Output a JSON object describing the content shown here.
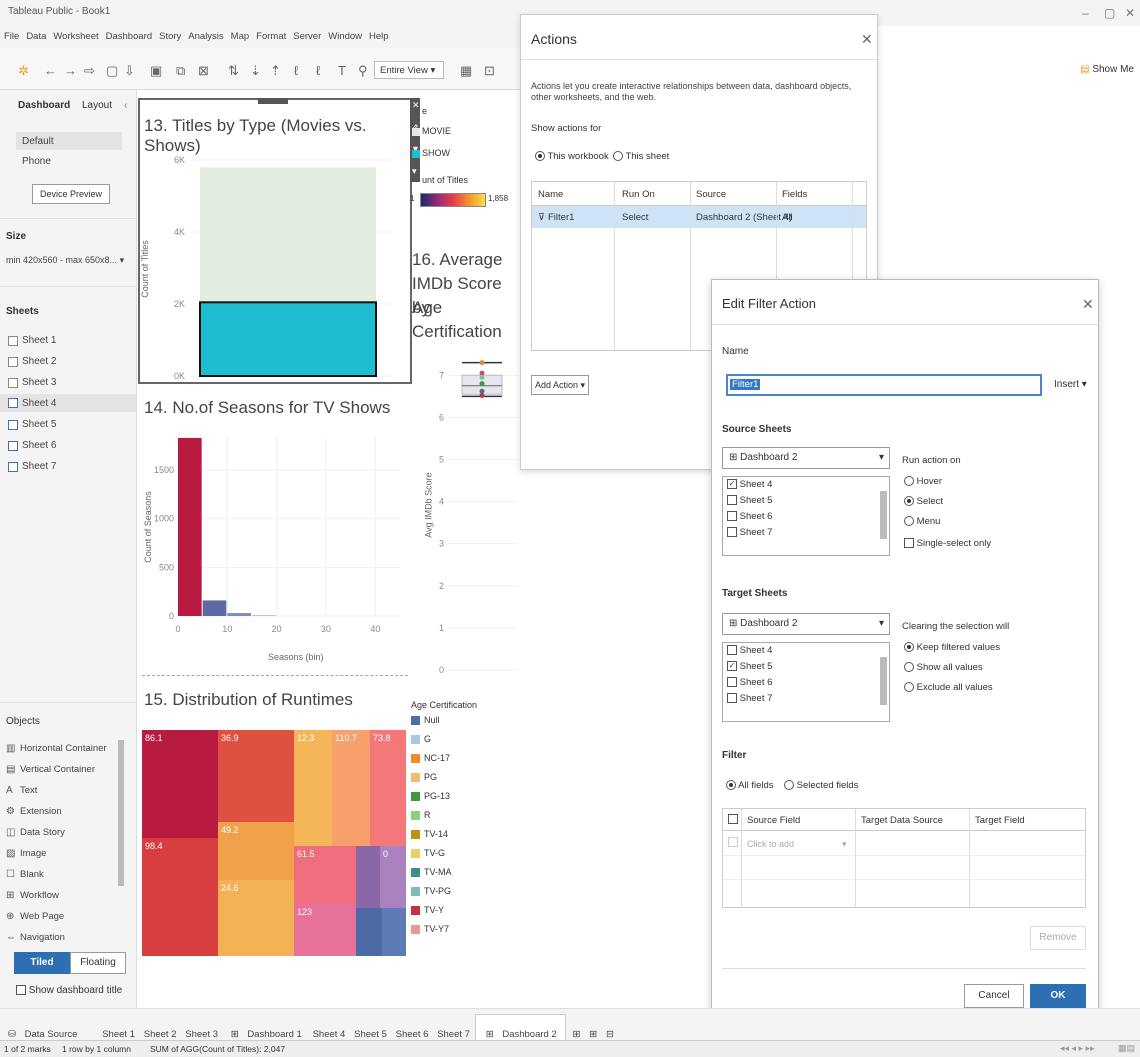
{
  "app": {
    "title": "Tableau Public - Book1",
    "show_me": "Show Me"
  },
  "menu": [
    "File",
    "Data",
    "Worksheet",
    "Dashboard",
    "Story",
    "Analysis",
    "Map",
    "Format",
    "Server",
    "Window",
    "Help"
  ],
  "toolbar": {
    "fit": "Entire View"
  },
  "left_panel": {
    "tabs": [
      "Dashboard",
      "Layout"
    ],
    "devices": [
      "Default",
      "Phone"
    ],
    "device_preview": "Device Preview",
    "size_label": "Size",
    "size_value": "min 420x560 - max 650x8...",
    "sheets_label": "Sheets",
    "sheets": [
      "Sheet 1",
      "Sheet 2",
      "Sheet 3",
      "Sheet 4",
      "Sheet 5",
      "Sheet 6",
      "Sheet 7"
    ],
    "objects_label": "Objects",
    "objects": [
      "Horizontal Container",
      "Vertical Container",
      "Text",
      "Extension",
      "Data Story",
      "Image",
      "Blank",
      "Workflow",
      "Web Page",
      "Navigation"
    ],
    "tiled": "Tiled",
    "floating": "Floating",
    "show_title": "Show dashboard title"
  },
  "dashboard": {
    "chart13_title": "13. Titles by Type (Movies vs. Shows)",
    "chart14_title": "14. No.of Seasons for TV Shows",
    "chart15_title": "15. Distribution of Runtimes",
    "chart16_title": [
      "16. Average",
      "IMDb Score by",
      "Age Certification"
    ],
    "type_legend": {
      "items": [
        "MOVIE",
        "SHOW"
      ],
      "count_label": "unt of Titles",
      "min": "1",
      "max": "1,858"
    },
    "age_legend": {
      "title": "Age Certification",
      "items": [
        "Null",
        "G",
        "NC-17",
        "PG",
        "PG-13",
        "R",
        "TV-14",
        "TV-G",
        "TV-MA",
        "TV-PG",
        "TV-Y",
        "TV-Y7"
      ],
      "colors": [
        "#4e6fa0",
        "#a8c7e0",
        "#f28c28",
        "#f7b96b",
        "#3e9a3c",
        "#8ccf7e",
        "#b8960f",
        "#e8cf68",
        "#3a8f88",
        "#7dbdb6",
        "#c9303a",
        "#f29597"
      ]
    },
    "treemap_labels": [
      "86.1",
      "36.9",
      "12.3",
      "110.7",
      "73.8",
      "98.4",
      "49.2",
      "61.5",
      "0",
      "24.6",
      "123"
    ]
  },
  "chart_data": [
    {
      "type": "bar",
      "title": "13. Titles by Type (Movies vs. Shows)",
      "ylabel": "Count of Titles",
      "yticks": [
        "0K",
        "2K",
        "4K",
        "6K"
      ],
      "ylim": [
        0,
        6000
      ],
      "series": [
        {
          "name": "MOVIE",
          "values": [
            3744
          ]
        },
        {
          "name": "SHOW",
          "values": [
            2047
          ]
        }
      ],
      "stacked": true
    },
    {
      "type": "bar",
      "title": "14. No.of Seasons for TV Shows",
      "xlabel": "Seasons (bin)",
      "ylabel": "Count of Seasons",
      "xticks": [
        "0",
        "10",
        "20",
        "30",
        "40"
      ],
      "yticks": [
        "0",
        "500",
        "1000",
        "1500"
      ],
      "ylim": [
        0,
        1850
      ],
      "bins": [
        0,
        5,
        10,
        15
      ],
      "values": [
        1830,
        160,
        30,
        8
      ]
    },
    {
      "type": "scatter",
      "ylabel": "Avg IMDb Score",
      "yticks": [
        "0",
        "1",
        "2",
        "3",
        "4",
        "5",
        "6",
        "7"
      ],
      "ylim": [
        0,
        7.6
      ]
    }
  ],
  "actions_dialog": {
    "title": "Actions",
    "description": "Actions let you create interactive relationships between data, dashboard objects, other worksheets, and the web.",
    "show_for": "Show actions for",
    "opt_workbook": "This workbook",
    "opt_sheet": "This sheet",
    "columns": [
      "Name",
      "Run On",
      "Source",
      "Fields"
    ],
    "row": {
      "name": "Filter1",
      "run_on": "Select",
      "source": "Dashboard 2 (Sheet 4)",
      "fields": "All"
    },
    "add_action": "Add Action"
  },
  "edit_dialog": {
    "title": "Edit Filter Action",
    "name_label": "Name",
    "name_value": "Filter1",
    "insert": "Insert",
    "source_label": "Source Sheets",
    "source_dd": "Dashboard 2",
    "source_sheets": [
      "Sheet 4",
      "Sheet 5",
      "Sheet 6",
      "Sheet 7"
    ],
    "run_on_label": "Run action on",
    "run_on": [
      "Hover",
      "Select",
      "Menu"
    ],
    "single_select": "Single-select only",
    "target_label": "Target Sheets",
    "target_dd": "Dashboard 2",
    "target_sheets": [
      "Sheet 4",
      "Sheet 5",
      "Sheet 6",
      "Sheet 7"
    ],
    "clearing_label": "Clearing the selection will",
    "clearing": [
      "Keep filtered values",
      "Show all values",
      "Exclude all values"
    ],
    "filter_label": "Filter",
    "all_fields": "All fields",
    "selected_fields": "Selected fields",
    "columns": [
      "Source Field",
      "Target Data Source",
      "Target Field"
    ],
    "click_to_add": "Click to add",
    "remove": "Remove",
    "cancel": "Cancel",
    "ok": "OK"
  },
  "tabs": [
    "Data Source",
    "Sheet 1",
    "Sheet 2",
    "Sheet 3",
    "Dashboard 1",
    "Sheet 4",
    "Sheet 5",
    "Sheet 6",
    "Sheet 7",
    "Dashboard 2"
  ],
  "status": {
    "marks": "1 of 2 marks",
    "rows": "1 row by 1 column",
    "sum": "SUM of AGG(Count of Titles): 2,047"
  }
}
